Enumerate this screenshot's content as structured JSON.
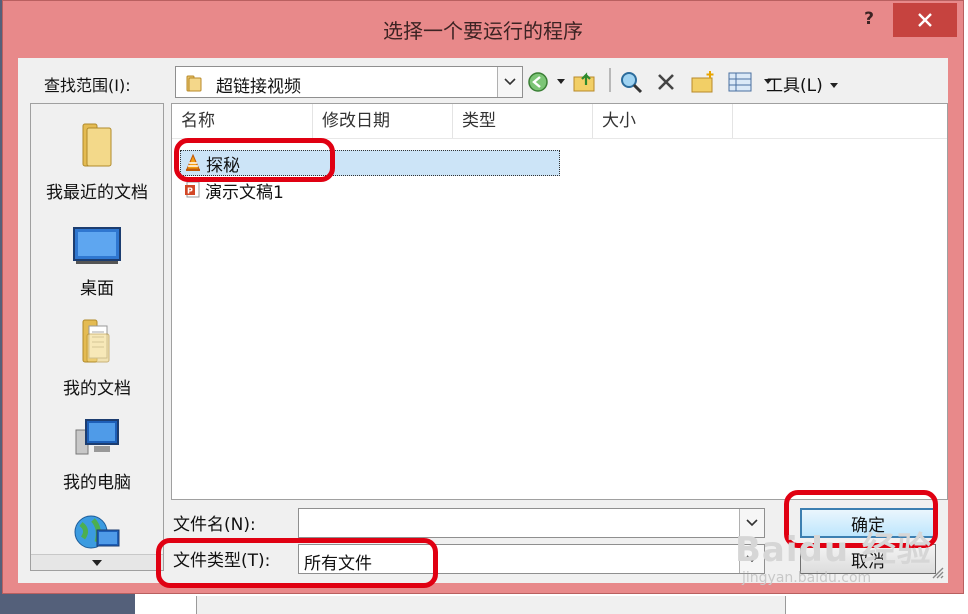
{
  "dialog": {
    "title": "选择一个要运行的程序",
    "help_label": "?",
    "close_label": "✕"
  },
  "toolbar": {
    "look_in_label": "查找范围(I):",
    "look_in_value": "超链接视频",
    "tools_label": "工具(L)",
    "icons": [
      "back-icon",
      "up-folder-icon",
      "search-web-icon",
      "delete-icon",
      "new-folder-icon",
      "views-icon"
    ]
  },
  "places": [
    {
      "label": "我最近的文档",
      "icon": "recent-folder-icon"
    },
    {
      "label": "桌面",
      "icon": "desktop-icon"
    },
    {
      "label": "我的文档",
      "icon": "documents-icon"
    },
    {
      "label": "我的电脑",
      "icon": "computer-icon"
    },
    {
      "label": "",
      "icon": "network-icon"
    }
  ],
  "columns": [
    "名称",
    "修改日期",
    "类型",
    "大小"
  ],
  "files": [
    {
      "name": "探秘",
      "icon": "vlc-icon",
      "selected": true
    },
    {
      "name": "演示文稿1",
      "icon": "powerpoint-icon",
      "selected": false
    }
  ],
  "filename": {
    "label": "文件名(N):",
    "value": ""
  },
  "filetype": {
    "label": "文件类型(T):",
    "value": "所有文件"
  },
  "buttons": {
    "ok": "确定",
    "cancel": "取消"
  },
  "watermark": {
    "line1": "Baidu 经验",
    "line2": "jingyan.baidu.com"
  },
  "colors": {
    "title_bar": "#e8898a",
    "close_button": "#c6433f",
    "highlight_marker": "#e00012",
    "selection": "#cce4f7"
  }
}
